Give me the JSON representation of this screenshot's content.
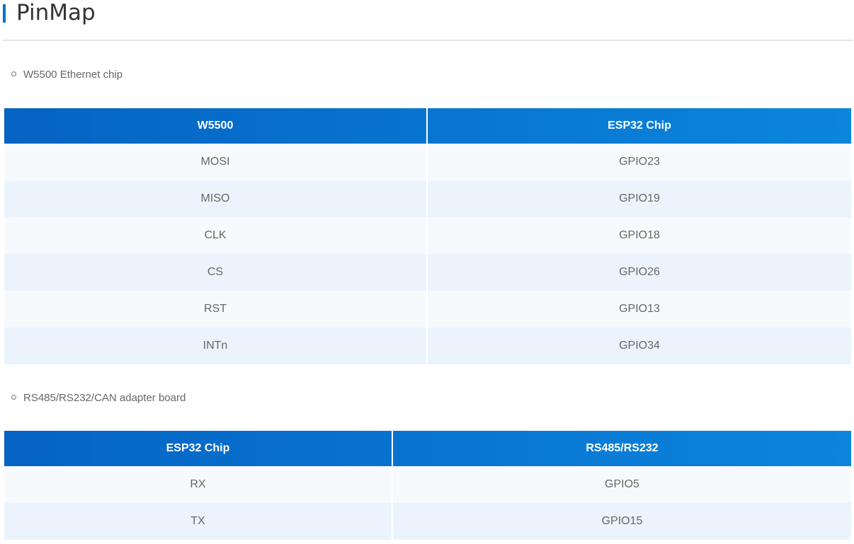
{
  "page": {
    "title": "PinMap"
  },
  "sections": [
    {
      "bullet": "W5500 Ethernet chip",
      "headers": [
        "W5500",
        "ESP32 Chip"
      ],
      "rows": [
        [
          "MOSI",
          "GPIO23"
        ],
        [
          "MISO",
          "GPIO19"
        ],
        [
          "CLK",
          "GPIO18"
        ],
        [
          "CS",
          "GPIO26"
        ],
        [
          "RST",
          "GPIO13"
        ],
        [
          "INTn",
          "GPIO34"
        ]
      ]
    },
    {
      "bullet": "RS485/RS232/CAN adapter board",
      "headers": [
        "ESP32 Chip",
        "RS485/RS232"
      ],
      "rows": [
        [
          "RX",
          "GPIO5"
        ],
        [
          "TX",
          "GPIO15"
        ]
      ]
    }
  ],
  "colors": {
    "heading_accent": "#0a6fc9",
    "table_header_start": "#0563c3",
    "table_header_end": "#0b86dc",
    "row_odd": "#f7fafd",
    "row_even": "#ebf4fc"
  }
}
